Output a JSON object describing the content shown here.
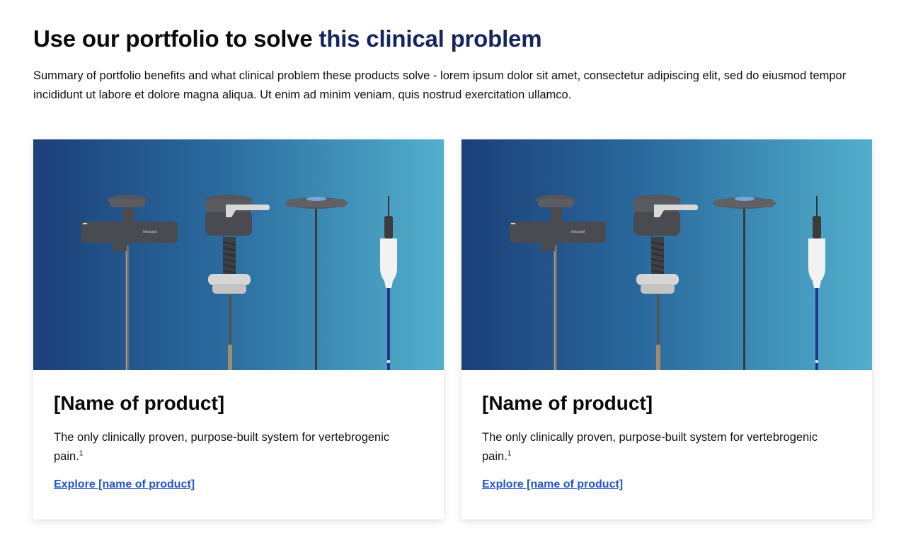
{
  "section": {
    "heading_part1": "Use our portfolio to solve ",
    "heading_part2": "this clinical problem",
    "summary": "Summary of portfolio benefits and what clinical problem these products solve - lorem ipsum dolor sit amet, consectetur adipiscing elit, sed do eiusmod tempor incididunt ut labore et dolore magna aliqua. Ut enim ad minim veniam, quis nostrud exercitation ullamco."
  },
  "cards": [
    {
      "title": "[Name of product]",
      "description": "The only clinically proven, purpose-built system for vertebrogenic pain.",
      "footnote": "1",
      "link_label": "Explore [name of product]",
      "image_brand": "Intracept"
    },
    {
      "title": "[Name of product]",
      "description": "The only clinically proven, purpose-built system for vertebrogenic pain.",
      "footnote": "1",
      "link_label": "Explore [name of product]",
      "image_brand": "Intracept"
    }
  ],
  "colors": {
    "heading_accent": "#13265e",
    "link": "#2456c9",
    "image_gradient_start": "#1c3f78",
    "image_gradient_end": "#52afcc"
  }
}
